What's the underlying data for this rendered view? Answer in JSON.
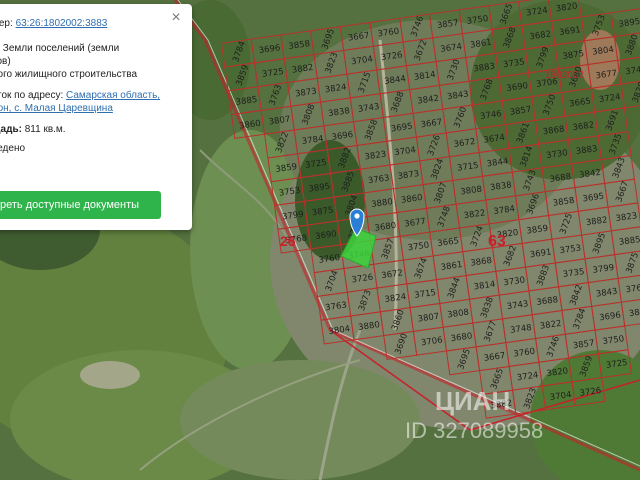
{
  "card": {
    "cadastral_label": "мер:",
    "cadastral_number": "63:26:1802002:3883",
    "category_line1_prefix": "ь:",
    "category_line1_value": "Земли поселений (земли",
    "category_line2": "тов)",
    "use_line": "ного жилищного строительства",
    "address_label": "сток по адресу:",
    "address_line1": "Самарская область,",
    "address_line2": "йон, с. Малая Царевщина",
    "area_label": "щадь:",
    "area_value": "811 кв.м.",
    "extra_line": "ведено",
    "button_label": "реть доступные документы",
    "close_glyph": "×"
  },
  "map": {
    "zone_labels": [
      "63",
      "26"
    ],
    "top_right_label": "1802002",
    "parcel_numbers": [
      "3784",
      "3696",
      "3858",
      "3695",
      "3667",
      "3760",
      "3746",
      "3857",
      "3750",
      "3665",
      "3724",
      "3820",
      "3859",
      "3725",
      "3882",
      "3823",
      "3704",
      "3726",
      "3672",
      "3674",
      "3861",
      "3868",
      "3682",
      "3691",
      "3753",
      "3895",
      "3885",
      "3763",
      "3873",
      "3824",
      "3715",
      "3844",
      "3814",
      "3730",
      "3883",
      "3735",
      "3799",
      "3875",
      "3804",
      "3880",
      "3860",
      "3807",
      "3808",
      "3838",
      "3743",
      "3688",
      "3842",
      "3843",
      "3768",
      "3690",
      "3706",
      "3680",
      "3677",
      "3748",
      "3822"
    ],
    "watermark_text": "ЦИАН",
    "watermark_id": "ID 327089958"
  },
  "colors": {
    "parcel_border": "#b8322c",
    "zone_border": "#c8202a",
    "selected_parcel": "#3bd43b",
    "marker": "#2a7fd4",
    "button": "#2fb34b"
  }
}
